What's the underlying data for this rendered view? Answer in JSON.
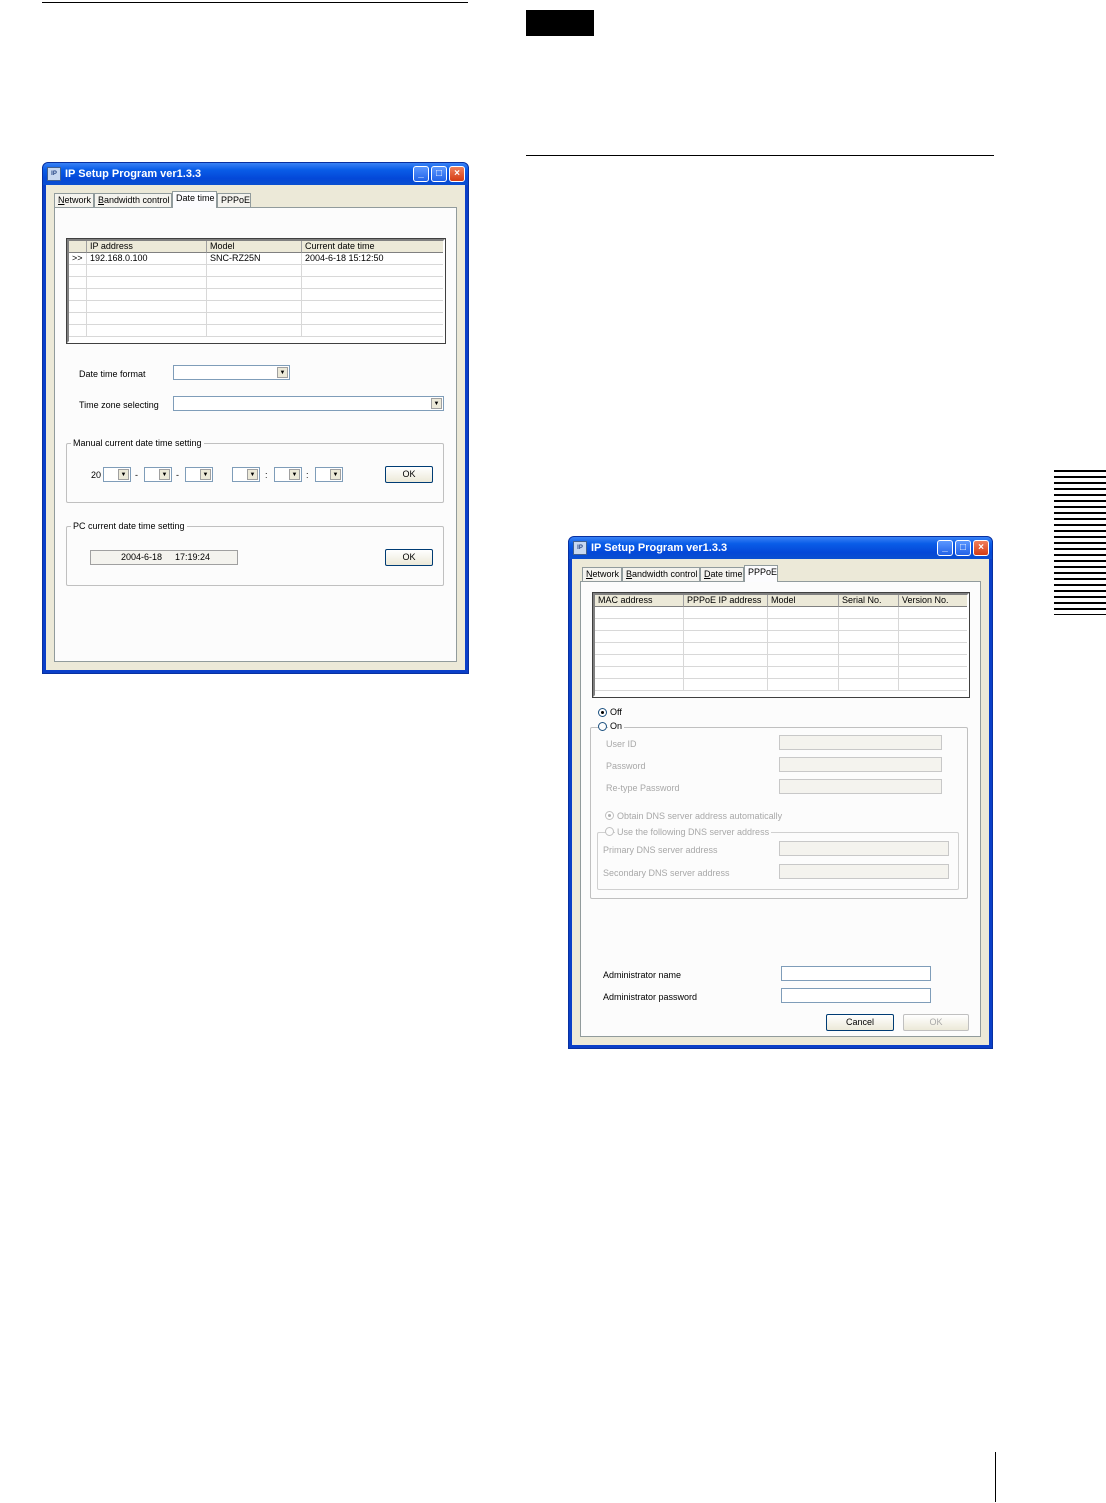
{
  "dialog_left": {
    "title": "IP Setup Program ver1.3.3",
    "tabs": [
      "Network",
      "Bandwidth control",
      "Date time",
      "PPPoE"
    ],
    "active_tab": "Date time",
    "list": {
      "headers": [
        "",
        "IP address",
        "Model",
        "Current date time"
      ],
      "rows": [
        {
          "marker": ">>",
          "ip": "192.168.0.100",
          "model": "SNC-RZ25N",
          "datetime": "2004-6-18  15:12:50"
        }
      ]
    },
    "date_time_format_label": "Date time format",
    "time_zone_label": "Time zone selecting",
    "manual_group_title": "Manual current date time setting",
    "manual_year_prefix": "20",
    "manual_date_sep": "-",
    "manual_time_sep": ":",
    "manual_ok": "OK",
    "pc_group_title": "PC current date time setting",
    "pc_date": "2004-6-18",
    "pc_time": "17:19:24",
    "pc_ok": "OK"
  },
  "dialog_right": {
    "title": "IP Setup Program ver1.3.3",
    "tabs": [
      "Network",
      "Bandwidth control",
      "Date time",
      "PPPoE"
    ],
    "active_tab": "PPPoE",
    "list": {
      "headers": [
        "MAC address",
        "PPPoE IP address",
        "Model",
        "Serial No.",
        "Version No."
      ]
    },
    "off_label": "Off",
    "on_label": "On",
    "user_id_label": "User ID",
    "password_label": "Password",
    "retype_label": "Re-type Password",
    "dns_auto_label": "Obtain DNS server address automatically",
    "dns_manual_label": "Use the following DNS server address",
    "primary_dns_label": "Primary DNS server address",
    "secondary_dns_label": "Secondary DNS server address",
    "admin_name_label": "Administrator name",
    "admin_password_label": "Administrator password",
    "cancel": "Cancel",
    "ok": "OK"
  }
}
